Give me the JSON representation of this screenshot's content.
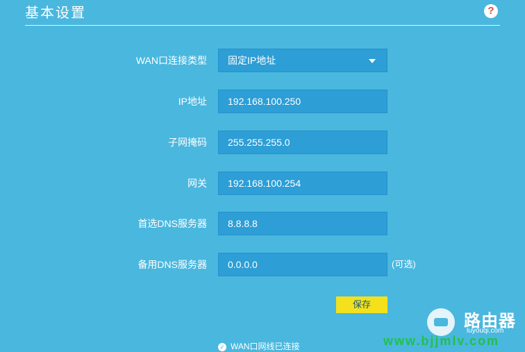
{
  "header": {
    "title": "基本设置",
    "help_glyph": "?"
  },
  "form": {
    "rows": [
      {
        "label": "WAN口连接类型",
        "value": "固定IP地址",
        "type": "select"
      },
      {
        "label": "IP地址",
        "value": "192.168.100.250",
        "type": "input"
      },
      {
        "label": "子网掩码",
        "value": "255.255.255.0",
        "type": "input"
      },
      {
        "label": "网关",
        "value": "192.168.100.254",
        "type": "input"
      },
      {
        "label": "首选DNS服务器",
        "value": "8.8.8.8",
        "type": "input"
      },
      {
        "label": "备用DNS服务器",
        "value": "0.0.0.0",
        "type": "input",
        "note": "(可选)"
      }
    ],
    "save_label": "保存"
  },
  "status": {
    "text": "WAN口网线已连接"
  },
  "watermark": {
    "name_cn": "路由器",
    "name_en": "luyouqi.com",
    "site": "www.bjjmlv.com"
  },
  "colors": {
    "background": "#4ab7de",
    "field": "#2d9ed6",
    "save_button": "#f4e11c",
    "help_icon": "#e5483f",
    "watermark_site": "#22c04a"
  },
  "icons": {
    "help": "question-circle-icon",
    "dropdown": "caret-down-icon",
    "status": "check-circle-icon",
    "watermark_logo": "router-logo-icon"
  }
}
